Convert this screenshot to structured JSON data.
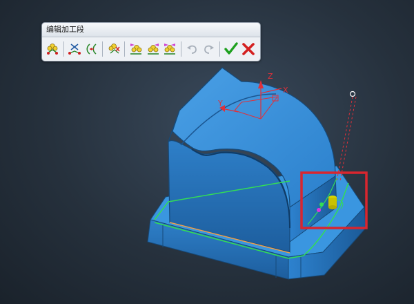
{
  "toolbar": {
    "title": "编辑加工段",
    "buttons": [
      {
        "icon": "select-segment-icon"
      },
      {
        "icon": "delete-segment-icon"
      },
      {
        "icon": "trim-segment-icon"
      },
      {
        "icon": "reverse-segment-icon"
      },
      {
        "icon": "add-start-segment-icon"
      },
      {
        "icon": "add-middle-segment-icon"
      },
      {
        "icon": "add-end-segment-icon"
      },
      {
        "icon": "undo-icon"
      },
      {
        "icon": "redo-icon"
      },
      {
        "icon": "confirm-icon"
      },
      {
        "icon": "cancel-icon"
      }
    ]
  },
  "viewport": {
    "axis_labels": {
      "x": "X",
      "y": "Y",
      "z": "Z"
    },
    "colors": {
      "model": "#2f86d4",
      "model_dark": "#1f5f9c",
      "toolpath": "#33dd55",
      "highlight_box": "#d9262f",
      "axis": "#e0303a"
    }
  }
}
